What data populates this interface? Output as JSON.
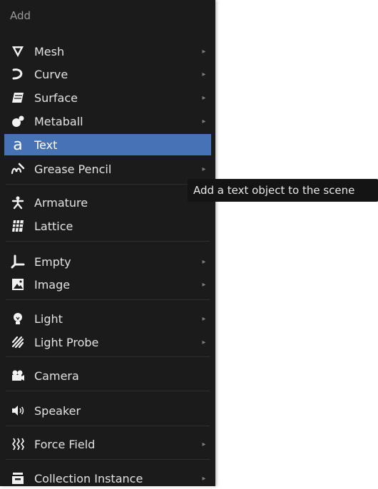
{
  "menu": {
    "title": "Add",
    "items": [
      {
        "label": "Mesh",
        "icon": "mesh-icon",
        "submenu": true
      },
      {
        "label": "Curve",
        "icon": "curve-icon",
        "submenu": true
      },
      {
        "label": "Surface",
        "icon": "surface-icon",
        "submenu": true
      },
      {
        "label": "Metaball",
        "icon": "metaball-icon",
        "submenu": true
      },
      {
        "label": "Text",
        "icon": "text-icon",
        "submenu": false,
        "active": true
      },
      {
        "label": "Grease Pencil",
        "icon": "grease-pencil-icon",
        "submenu": true
      },
      {
        "label": "Armature",
        "icon": "armature-icon",
        "submenu": false
      },
      {
        "label": "Lattice",
        "icon": "lattice-icon",
        "submenu": false
      },
      {
        "label": "Empty",
        "icon": "empty-icon",
        "submenu": true
      },
      {
        "label": "Image",
        "icon": "image-icon",
        "submenu": true
      },
      {
        "label": "Light",
        "icon": "light-icon",
        "submenu": true
      },
      {
        "label": "Light Probe",
        "icon": "light-probe-icon",
        "submenu": true
      },
      {
        "label": "Camera",
        "icon": "camera-icon",
        "submenu": false
      },
      {
        "label": "Speaker",
        "icon": "speaker-icon",
        "submenu": false
      },
      {
        "label": "Force Field",
        "icon": "force-field-icon",
        "submenu": true
      },
      {
        "label": "Collection Instance",
        "icon": "collection-instance-icon",
        "submenu": true
      }
    ]
  },
  "tooltip": {
    "text": "Add a text object to the scene"
  },
  "colors": {
    "menu_bg": "#1b1b1b",
    "highlight": "#4772b3",
    "text": "#e3e3e3"
  }
}
